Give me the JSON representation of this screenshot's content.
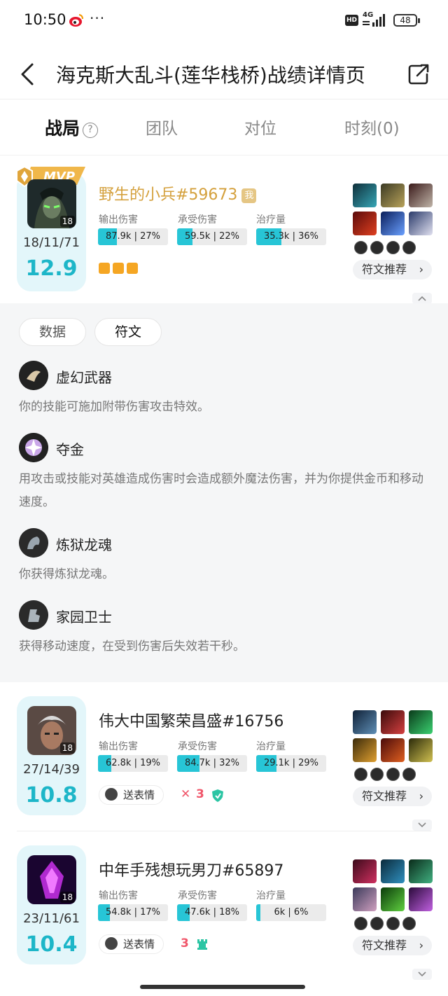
{
  "status_bar": {
    "time": "10:50",
    "dots": "···",
    "hd": "HD",
    "network": "4G",
    "battery": "48"
  },
  "header": {
    "title": "海克斯大乱斗(莲华栈桥)战绩详情页"
  },
  "tabs": [
    {
      "label": "战局",
      "active": true,
      "help": "?"
    },
    {
      "label": "团队"
    },
    {
      "label": "对位"
    },
    {
      "label": "时刻(0)"
    }
  ],
  "stat_labels": {
    "damage": "输出伤害",
    "taken": "承受伤害",
    "heal": "治疗量"
  },
  "players": [
    {
      "name": "野生的小兵#59673",
      "mvp": "MVP",
      "me_badge": "我",
      "level": "18",
      "kda": "18/11/71",
      "score": "12.9",
      "damage": {
        "text": "87.9k | 27%",
        "pct": 27
      },
      "taken": {
        "text": "59.5k | 22%",
        "pct": 22
      },
      "heal": {
        "text": "35.3k | 36%",
        "pct": 36
      },
      "rune_button": "符文推荐",
      "chevron": "›"
    },
    {
      "name": "伟大中国繁荣昌盛#16756",
      "level": "18",
      "kda": "27/14/39",
      "score": "10.8",
      "damage": {
        "text": "62.8k | 19%",
        "pct": 19
      },
      "taken": {
        "text": "84.7k | 32%",
        "pct": 32
      },
      "heal": {
        "text": "29.1k | 29%",
        "pct": 29
      },
      "send_label": "送表情",
      "marks": [
        "✕",
        "3"
      ],
      "rune_button": "符文推荐",
      "chevron": "›"
    },
    {
      "name": "中年手残想玩男刀#65897",
      "level": "18",
      "kda": "23/11/61",
      "score": "10.4",
      "damage": {
        "text": "54.8k | 17%",
        "pct": 17
      },
      "taken": {
        "text": "47.6k | 18%",
        "pct": 18
      },
      "heal": {
        "text": "6k | 6%",
        "pct": 6
      },
      "send_label": "送表情",
      "marks": [
        "3"
      ],
      "rune_button": "符文推荐",
      "chevron": "›"
    }
  ],
  "runes_panel": {
    "tabs": [
      "数据",
      "符文"
    ],
    "runes": [
      {
        "name": "虚幻武器",
        "desc": "你的技能可施加附带伤害攻击特效。"
      },
      {
        "name": "夺金",
        "desc": "用攻击或技能对英雄造成伤害时会造成额外魔法伤害，并为你提供金币和移动速度。"
      },
      {
        "name": "炼狱龙魂",
        "desc": "你获得炼狱龙魂。"
      },
      {
        "name": "家园卫士",
        "desc": "获得移动速度，在受到伤害后失效若干秒。"
      }
    ]
  },
  "colors": {
    "accent": "#27c5d6",
    "score": "#1db6c8",
    "mvp_gold": "#d4a03c",
    "panel_bg": "#f5f6f7"
  }
}
